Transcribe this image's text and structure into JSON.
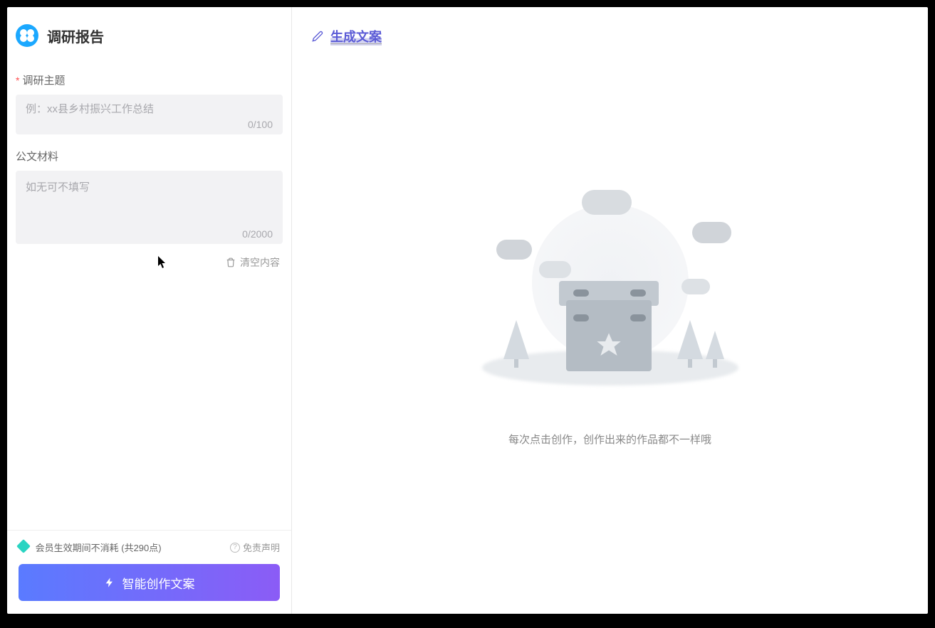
{
  "header": {
    "title": "调研报告"
  },
  "form": {
    "topic": {
      "label": "调研主题",
      "placeholder": "例：xx县乡村振兴工作总结",
      "counter": "0/100"
    },
    "material": {
      "label": "公文材料",
      "placeholder": "如无可不填写",
      "counter": "0/2000"
    },
    "clear_label": "清空内容"
  },
  "footer": {
    "membership_text": "会员生效期间不消耗 (共290点)",
    "disclaimer_label": "免责声明",
    "create_button_label": "智能创作文案"
  },
  "right": {
    "generate_title": "生成文案",
    "empty_text": "每次点击创作，创作出来的作品都不一样哦"
  }
}
